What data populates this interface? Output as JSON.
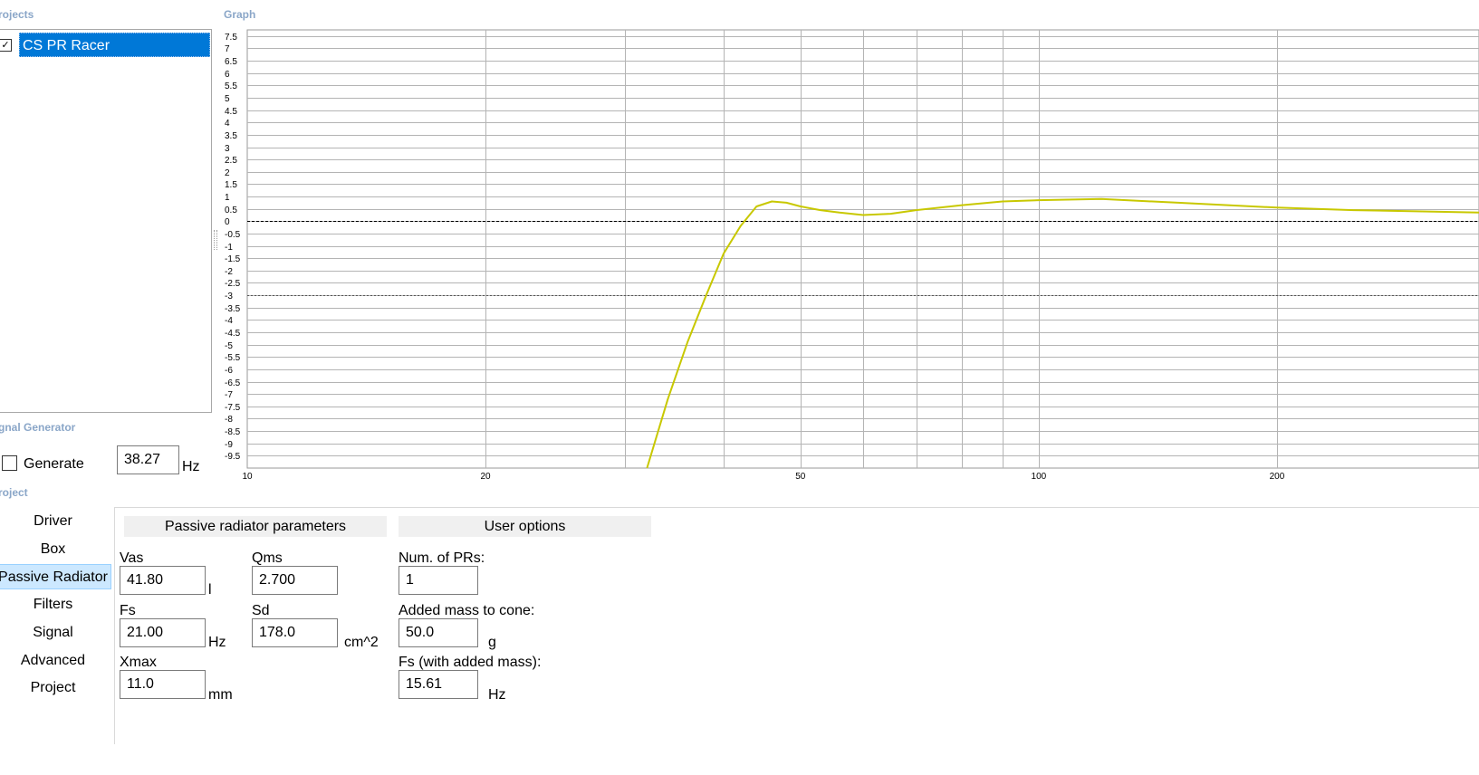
{
  "sections": {
    "projects": "rojects",
    "graph": "Graph",
    "signal_generator": "gnal Generator",
    "project": "roject"
  },
  "projects_list": {
    "items": [
      {
        "name": "CS PR Racer",
        "checked": true,
        "selected": true
      }
    ]
  },
  "signal_generator": {
    "generate_label": "Generate",
    "generate_checked": false,
    "frequency_value": "38.27",
    "frequency_unit": "Hz"
  },
  "nav": {
    "items": [
      {
        "label": "Driver"
      },
      {
        "label": "Box"
      },
      {
        "label": "Passive Radiator",
        "selected": true
      },
      {
        "label": "Filters"
      },
      {
        "label": "Signal"
      },
      {
        "label": "Advanced"
      },
      {
        "label": "Project"
      }
    ]
  },
  "passive_radiator": {
    "header": "Passive radiator parameters",
    "vas": {
      "label": "Vas",
      "value": "41.80",
      "unit": "l"
    },
    "qms": {
      "label": "Qms",
      "value": "2.700"
    },
    "fs": {
      "label": "Fs",
      "value": "21.00",
      "unit": "Hz"
    },
    "sd": {
      "label": "Sd",
      "value": "178.0",
      "unit": "cm^2"
    },
    "xmax": {
      "label": "Xmax",
      "value": "11.0",
      "unit": "mm"
    }
  },
  "user_options": {
    "header": "User options",
    "num_prs": {
      "label": "Num. of PRs:",
      "value": "1"
    },
    "added_mass": {
      "label": "Added mass to cone:",
      "value": "50.0",
      "unit": "g"
    },
    "fs_added": {
      "label": "Fs (with added mass):",
      "value": "15.61",
      "unit": "Hz"
    }
  },
  "chart_data": {
    "type": "line",
    "title": "",
    "xlabel": "",
    "ylabel": "",
    "x_scale": "log",
    "xlim": [
      10,
      360
    ],
    "ylim": [
      -10,
      7.75
    ],
    "x_ticks": [
      10,
      20,
      50,
      100,
      200
    ],
    "x_gridlines": [
      20,
      30,
      40,
      50,
      60,
      70,
      80,
      90,
      100,
      200
    ],
    "y_ticks": [
      7.5,
      7,
      6.5,
      6,
      5.5,
      5,
      4.5,
      4,
      3.5,
      3,
      2.5,
      2,
      1.5,
      1,
      0.5,
      0,
      -0.5,
      -1,
      -1.5,
      -2,
      -2.5,
      -3,
      -3.5,
      -4,
      -4.5,
      -5,
      -5.5,
      -6,
      -6.5,
      -7,
      -7.5,
      -8,
      -8.5,
      -9,
      -9.5
    ],
    "reference_lines": [
      0,
      -3
    ],
    "grid": true,
    "series": [
      {
        "color": "#c8c800",
        "x": [
          32,
          34,
          36,
          38,
          40,
          42,
          44,
          46,
          48,
          50,
          53,
          56,
          60,
          65,
          70,
          80,
          90,
          100,
          120,
          150,
          200,
          250,
          300,
          360
        ],
        "y": [
          -10,
          -7.2,
          -4.9,
          -3.0,
          -1.3,
          -0.2,
          0.6,
          0.8,
          0.75,
          0.6,
          0.45,
          0.35,
          0.25,
          0.3,
          0.45,
          0.65,
          0.8,
          0.85,
          0.9,
          0.75,
          0.55,
          0.45,
          0.4,
          0.35
        ]
      }
    ]
  }
}
